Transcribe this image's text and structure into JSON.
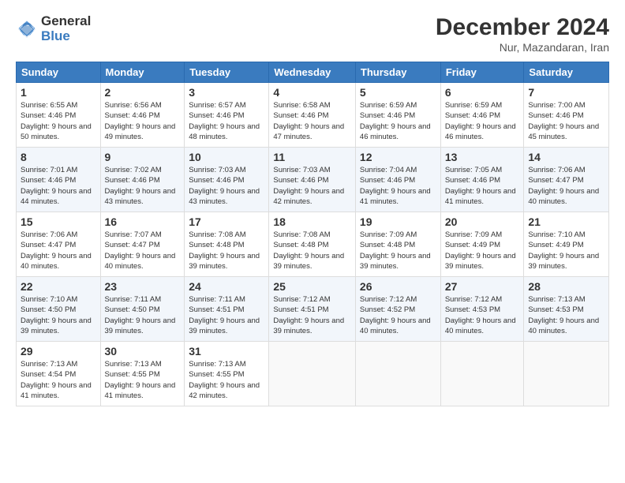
{
  "logo": {
    "general": "General",
    "blue": "Blue"
  },
  "header": {
    "month_title": "December 2024",
    "location": "Nur, Mazandaran, Iran"
  },
  "weekdays": [
    "Sunday",
    "Monday",
    "Tuesday",
    "Wednesday",
    "Thursday",
    "Friday",
    "Saturday"
  ],
  "weeks": [
    [
      {
        "day": "1",
        "sunrise": "Sunrise: 6:55 AM",
        "sunset": "Sunset: 4:46 PM",
        "daylight": "Daylight: 9 hours and 50 minutes."
      },
      {
        "day": "2",
        "sunrise": "Sunrise: 6:56 AM",
        "sunset": "Sunset: 4:46 PM",
        "daylight": "Daylight: 9 hours and 49 minutes."
      },
      {
        "day": "3",
        "sunrise": "Sunrise: 6:57 AM",
        "sunset": "Sunset: 4:46 PM",
        "daylight": "Daylight: 9 hours and 48 minutes."
      },
      {
        "day": "4",
        "sunrise": "Sunrise: 6:58 AM",
        "sunset": "Sunset: 4:46 PM",
        "daylight": "Daylight: 9 hours and 47 minutes."
      },
      {
        "day": "5",
        "sunrise": "Sunrise: 6:59 AM",
        "sunset": "Sunset: 4:46 PM",
        "daylight": "Daylight: 9 hours and 46 minutes."
      },
      {
        "day": "6",
        "sunrise": "Sunrise: 6:59 AM",
        "sunset": "Sunset: 4:46 PM",
        "daylight": "Daylight: 9 hours and 46 minutes."
      },
      {
        "day": "7",
        "sunrise": "Sunrise: 7:00 AM",
        "sunset": "Sunset: 4:46 PM",
        "daylight": "Daylight: 9 hours and 45 minutes."
      }
    ],
    [
      {
        "day": "8",
        "sunrise": "Sunrise: 7:01 AM",
        "sunset": "Sunset: 4:46 PM",
        "daylight": "Daylight: 9 hours and 44 minutes."
      },
      {
        "day": "9",
        "sunrise": "Sunrise: 7:02 AM",
        "sunset": "Sunset: 4:46 PM",
        "daylight": "Daylight: 9 hours and 43 minutes."
      },
      {
        "day": "10",
        "sunrise": "Sunrise: 7:03 AM",
        "sunset": "Sunset: 4:46 PM",
        "daylight": "Daylight: 9 hours and 43 minutes."
      },
      {
        "day": "11",
        "sunrise": "Sunrise: 7:03 AM",
        "sunset": "Sunset: 4:46 PM",
        "daylight": "Daylight: 9 hours and 42 minutes."
      },
      {
        "day": "12",
        "sunrise": "Sunrise: 7:04 AM",
        "sunset": "Sunset: 4:46 PM",
        "daylight": "Daylight: 9 hours and 41 minutes."
      },
      {
        "day": "13",
        "sunrise": "Sunrise: 7:05 AM",
        "sunset": "Sunset: 4:46 PM",
        "daylight": "Daylight: 9 hours and 41 minutes."
      },
      {
        "day": "14",
        "sunrise": "Sunrise: 7:06 AM",
        "sunset": "Sunset: 4:47 PM",
        "daylight": "Daylight: 9 hours and 40 minutes."
      }
    ],
    [
      {
        "day": "15",
        "sunrise": "Sunrise: 7:06 AM",
        "sunset": "Sunset: 4:47 PM",
        "daylight": "Daylight: 9 hours and 40 minutes."
      },
      {
        "day": "16",
        "sunrise": "Sunrise: 7:07 AM",
        "sunset": "Sunset: 4:47 PM",
        "daylight": "Daylight: 9 hours and 40 minutes."
      },
      {
        "day": "17",
        "sunrise": "Sunrise: 7:08 AM",
        "sunset": "Sunset: 4:48 PM",
        "daylight": "Daylight: 9 hours and 39 minutes."
      },
      {
        "day": "18",
        "sunrise": "Sunrise: 7:08 AM",
        "sunset": "Sunset: 4:48 PM",
        "daylight": "Daylight: 9 hours and 39 minutes."
      },
      {
        "day": "19",
        "sunrise": "Sunrise: 7:09 AM",
        "sunset": "Sunset: 4:48 PM",
        "daylight": "Daylight: 9 hours and 39 minutes."
      },
      {
        "day": "20",
        "sunrise": "Sunrise: 7:09 AM",
        "sunset": "Sunset: 4:49 PM",
        "daylight": "Daylight: 9 hours and 39 minutes."
      },
      {
        "day": "21",
        "sunrise": "Sunrise: 7:10 AM",
        "sunset": "Sunset: 4:49 PM",
        "daylight": "Daylight: 9 hours and 39 minutes."
      }
    ],
    [
      {
        "day": "22",
        "sunrise": "Sunrise: 7:10 AM",
        "sunset": "Sunset: 4:50 PM",
        "daylight": "Daylight: 9 hours and 39 minutes."
      },
      {
        "day": "23",
        "sunrise": "Sunrise: 7:11 AM",
        "sunset": "Sunset: 4:50 PM",
        "daylight": "Daylight: 9 hours and 39 minutes."
      },
      {
        "day": "24",
        "sunrise": "Sunrise: 7:11 AM",
        "sunset": "Sunset: 4:51 PM",
        "daylight": "Daylight: 9 hours and 39 minutes."
      },
      {
        "day": "25",
        "sunrise": "Sunrise: 7:12 AM",
        "sunset": "Sunset: 4:51 PM",
        "daylight": "Daylight: 9 hours and 39 minutes."
      },
      {
        "day": "26",
        "sunrise": "Sunrise: 7:12 AM",
        "sunset": "Sunset: 4:52 PM",
        "daylight": "Daylight: 9 hours and 40 minutes."
      },
      {
        "day": "27",
        "sunrise": "Sunrise: 7:12 AM",
        "sunset": "Sunset: 4:53 PM",
        "daylight": "Daylight: 9 hours and 40 minutes."
      },
      {
        "day": "28",
        "sunrise": "Sunrise: 7:13 AM",
        "sunset": "Sunset: 4:53 PM",
        "daylight": "Daylight: 9 hours and 40 minutes."
      }
    ],
    [
      {
        "day": "29",
        "sunrise": "Sunrise: 7:13 AM",
        "sunset": "Sunset: 4:54 PM",
        "daylight": "Daylight: 9 hours and 41 minutes."
      },
      {
        "day": "30",
        "sunrise": "Sunrise: 7:13 AM",
        "sunset": "Sunset: 4:55 PM",
        "daylight": "Daylight: 9 hours and 41 minutes."
      },
      {
        "day": "31",
        "sunrise": "Sunrise: 7:13 AM",
        "sunset": "Sunset: 4:55 PM",
        "daylight": "Daylight: 9 hours and 42 minutes."
      },
      null,
      null,
      null,
      null
    ]
  ]
}
